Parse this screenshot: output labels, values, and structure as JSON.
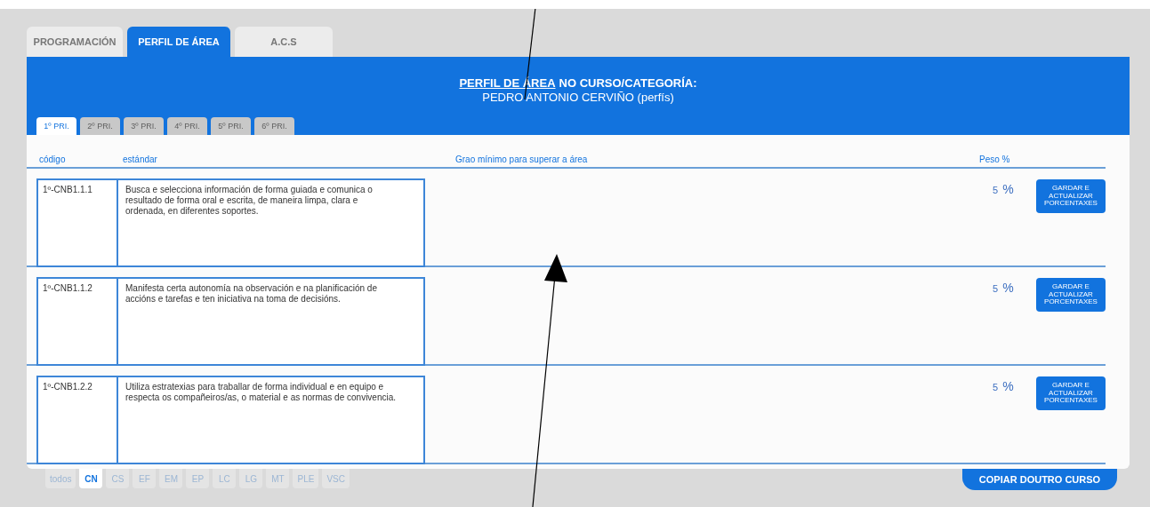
{
  "main_tabs": [
    {
      "label": "PROGRAMACIÓN",
      "selected": false
    },
    {
      "label": "PERFIL DE ÁREA",
      "selected": true
    },
    {
      "label": "A.C.S",
      "selected": false
    }
  ],
  "header": {
    "title_link": "PERFIL DE ÁREA",
    "title_rest": "NO CURSO/CATEGORÍA:",
    "subtitle": "PEDRO ANTONIO CERVIÑO (perfís)"
  },
  "course_tabs": [
    {
      "label": "1º PRI.",
      "selected": true
    },
    {
      "label": "2º PRI.",
      "selected": false
    },
    {
      "label": "3º PRI.",
      "selected": false
    },
    {
      "label": "4º PRI.",
      "selected": false
    },
    {
      "label": "5º PRI.",
      "selected": false
    },
    {
      "label": "6º PRI.",
      "selected": false
    }
  ],
  "table": {
    "columns": [
      "código",
      "estándar",
      "Grao mínimo para superar a área",
      "Peso %"
    ],
    "rows": [
      {
        "code": "1º-CNB1.1.1",
        "standard": "Busca e selecciona información de forma guiada e comunica o resultado de forma oral e escrita, de maneira limpa, clara e ordenada, en diferentes soportes.",
        "weight": "5",
        "unit": "%",
        "button": "GARDAR E ACTUALIZAR PORCENTAXES"
      },
      {
        "code": "1º-CNB1.1.2",
        "standard": "Manifesta certa autonomía na observación e na planificación de accións e tarefas e ten iniciativa na toma de decisións.",
        "weight": "5",
        "unit": "%",
        "button": "GARDAR E ACTUALIZAR PORCENTAXES"
      },
      {
        "code": "1º-CNB1.2.2",
        "standard": "Utiliza estratexias para traballar de forma individual e en equipo e respecta os compañeiros/as, o material e as normas de convivencia.",
        "weight": "5",
        "unit": "%",
        "button": "GARDAR E ACTUALIZAR PORCENTAXES"
      }
    ]
  },
  "area_tabs": [
    {
      "label": "todos",
      "selected": false
    },
    {
      "label": "CN",
      "selected": true
    },
    {
      "label": "CS",
      "selected": false
    },
    {
      "label": "EF",
      "selected": false
    },
    {
      "label": "EM",
      "selected": false
    },
    {
      "label": "EP",
      "selected": false
    },
    {
      "label": "LC",
      "selected": false
    },
    {
      "label": "LG",
      "selected": false
    },
    {
      "label": "MT",
      "selected": false
    },
    {
      "label": "PLE",
      "selected": false
    },
    {
      "label": "VSC",
      "selected": false
    }
  ],
  "copy_button": "COPIAR DOUTRO CURSO"
}
